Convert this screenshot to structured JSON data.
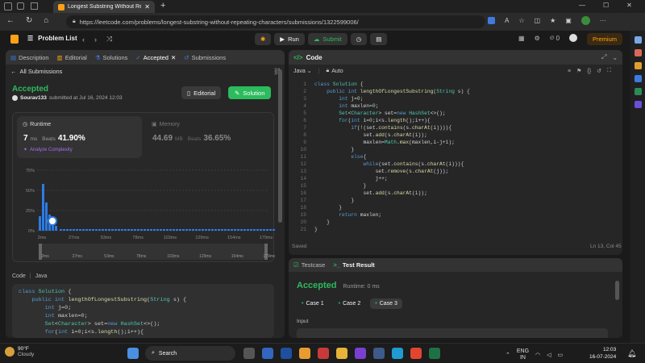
{
  "browser": {
    "tab_title": "Longest Substring Without Repe...",
    "url": "https://leetcode.com/problems/longest-substring-without-repeating-characters/submissions/1322599006/"
  },
  "nav": {
    "problem_list": "Problem List",
    "run": "Run",
    "submit": "Submit",
    "fire_count": "0",
    "premium": "Premium"
  },
  "left_tabs": [
    {
      "label": "Description"
    },
    {
      "label": "Editorial"
    },
    {
      "label": "Solutions"
    },
    {
      "label": "Accepted"
    },
    {
      "label": "Submissions"
    }
  ],
  "submission": {
    "back": "All Submissions",
    "status": "Accepted",
    "user": "Sourav133",
    "submitted": "submitted at Jul 16, 2024 12:03",
    "editorial_btn": "Editorial",
    "solution_btn": "Solution"
  },
  "runtime": {
    "label": "Runtime",
    "value": "7",
    "unit": "ms",
    "beats_label": "Beats",
    "beats": "41.90%",
    "analyze": "Analyze Complexity"
  },
  "memory": {
    "label": "Memory",
    "value": "44.69",
    "unit": "MB",
    "beats_label": "Beats",
    "beats": "36.65%"
  },
  "chart_data": {
    "type": "bar",
    "y_ticks": [
      "75%",
      "50%",
      "25%",
      "0%"
    ],
    "x_ticks": [
      "2ms",
      "27ms",
      "53ms",
      "78ms",
      "103ms",
      "129ms",
      "154ms",
      "179ms"
    ],
    "mini_ticks": [
      "2ms",
      "27ms",
      "53ms",
      "78ms",
      "103ms",
      "129ms",
      "154ms",
      "179ms"
    ],
    "bars": [
      {
        "x": "2ms",
        "value": 0.18
      },
      {
        "x": "~3ms",
        "value": 0.58
      },
      {
        "x": "~4ms",
        "value": 0.35
      },
      {
        "x": "~5ms",
        "value": 0.2
      },
      {
        "x": "7ms",
        "value": 0.12
      },
      {
        "x": "~9ms",
        "value": 0.06
      }
    ],
    "ylim": [
      0,
      0.8
    ],
    "accent": "#2c7be5"
  },
  "code_header": {
    "label": "Code",
    "lang": "Java"
  },
  "editor": {
    "title": "Code",
    "language": "Java",
    "mode": "Auto",
    "saved": "Saved",
    "cursor": "Ln 13, Col 45"
  },
  "code_lines": [
    {
      "n": "1",
      "t": "class Solution {"
    },
    {
      "n": "2",
      "t": "    public int lengthOfLongestSubstring(String s) {"
    },
    {
      "n": "3",
      "t": "        int j=0;"
    },
    {
      "n": "4",
      "t": "        int maxlen=0;"
    },
    {
      "n": "5",
      "t": "        Set<Character> set=new HashSet<>();"
    },
    {
      "n": "6",
      "t": "        for(int i=0;i<s.length();i++){"
    },
    {
      "n": "7",
      "t": "            if(!(set.contains(s.charAt(i)))){"
    },
    {
      "n": "8",
      "t": "                set.add(s.charAt(i));"
    },
    {
      "n": "9",
      "t": "                maxlen=Math.max(maxlen,i-j+1);"
    },
    {
      "n": "10",
      "t": "            }"
    },
    {
      "n": "11",
      "t": "            else{"
    },
    {
      "n": "12",
      "t": "                while(set.contains(s.charAt(i))){"
    },
    {
      "n": "13",
      "t": "                    set.remove(s.charAt(j));"
    },
    {
      "n": "14",
      "t": "                    j++;"
    },
    {
      "n": "15",
      "t": "                }"
    },
    {
      "n": "16",
      "t": "                set.add(s.charAt(i));"
    },
    {
      "n": "17",
      "t": "            }"
    },
    {
      "n": "18",
      "t": "        }"
    },
    {
      "n": "19",
      "t": "        return maxlen;"
    },
    {
      "n": "20",
      "t": "    }"
    },
    {
      "n": "21",
      "t": "}"
    }
  ],
  "left_code": [
    "class Solution {",
    "    public int lengthOfLongestSubstring(String s) {",
    "        int j=0;",
    "        int maxlen=0;",
    "        Set<Character> set=new HashSet<>();",
    "        for(int i=0;i<s.length();i++){"
  ],
  "testpanel": {
    "testcase": "Testcase",
    "result": "Test Result",
    "status": "Accepted",
    "runtime": "Runtime: 0 ms",
    "cases": [
      "Case 1",
      "Case 2",
      "Case 3"
    ],
    "input_label": "Input"
  },
  "taskbar": {
    "weather": "90°F",
    "weather_desc": "Cloudy",
    "search": "Search",
    "lang1": "ENG",
    "lang2": "IN",
    "time": "12:03",
    "date": "16-07-2024"
  }
}
